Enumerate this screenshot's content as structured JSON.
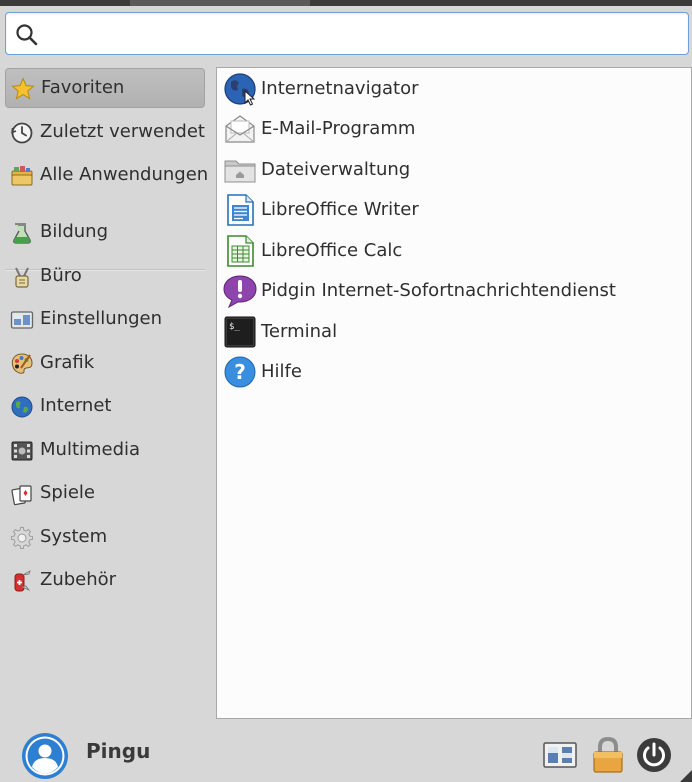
{
  "search": {
    "placeholder": "",
    "value": ""
  },
  "categories": [
    {
      "label": "Favoriten",
      "icon": "star-icon",
      "selected": true
    },
    {
      "label": "Zuletzt verwendet",
      "icon": "clock-icon"
    },
    {
      "label": "Alle Anwendungen",
      "icon": "folder-apps-icon"
    },
    {
      "label": "Bildung",
      "icon": "education-icon"
    },
    {
      "label": "Büro",
      "icon": "office-icon"
    },
    {
      "label": "Einstellungen",
      "icon": "settings-panel-icon"
    },
    {
      "label": "Grafik",
      "icon": "graphics-palette-icon"
    },
    {
      "label": "Internet",
      "icon": "globe-icon"
    },
    {
      "label": "Multimedia",
      "icon": "multimedia-icon"
    },
    {
      "label": "Spiele",
      "icon": "games-icon"
    },
    {
      "label": "System",
      "icon": "gear-icon"
    },
    {
      "label": "Zubehör",
      "icon": "accessories-knife-icon"
    }
  ],
  "apps": [
    {
      "label": "Internetnavigator",
      "icon": "web-browser-icon"
    },
    {
      "label": "E-Mail-Programm",
      "icon": "mail-icon"
    },
    {
      "label": "Dateiverwaltung",
      "icon": "file-manager-icon"
    },
    {
      "label": "LibreOffice Writer",
      "icon": "libreoffice-writer-icon"
    },
    {
      "label": "LibreOffice Calc",
      "icon": "libreoffice-calc-icon"
    },
    {
      "label": "Pidgin Internet-Sofortnachrichtendienst",
      "icon": "pidgin-icon"
    },
    {
      "label": "Terminal",
      "icon": "terminal-icon"
    },
    {
      "label": "Hilfe",
      "icon": "help-icon"
    }
  ],
  "user": {
    "name": "Pingu",
    "avatar": "user-avatar-icon"
  },
  "actions": [
    {
      "name": "settings-manager-button",
      "icon": "settings-manager-icon"
    },
    {
      "name": "lock-screen-button",
      "icon": "lock-icon"
    },
    {
      "name": "logout-button",
      "icon": "power-icon"
    }
  ],
  "colors": {
    "background": "#d7d7d7",
    "content_background": "#fcfcfc",
    "search_border": "#6fa0d8",
    "selected_item": "#b9b9b9",
    "accent_blue": "#2f7fd0"
  }
}
